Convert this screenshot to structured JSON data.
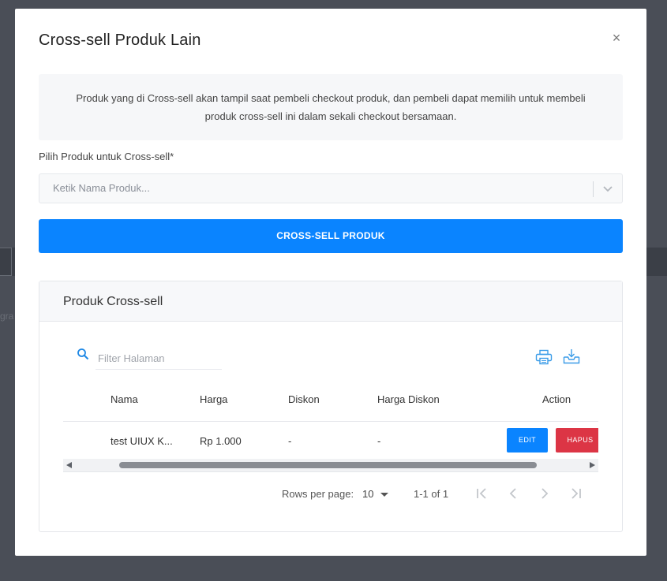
{
  "backdrop": {
    "partial_text": "gra"
  },
  "modal": {
    "title": "Cross-sell Produk Lain",
    "close_label": "×",
    "info_text": "Produk yang di Cross-sell akan tampil saat pembeli checkout produk, dan pembeli dapat memilih untuk membeli produk cross-sell ini dalam sekali checkout bersamaan.",
    "field_label": "Pilih Produk untuk Cross-sell*",
    "select_placeholder": "Ketik Nama Produk...",
    "submit_label": "CROSS-SELL PRODUK"
  },
  "card": {
    "title": "Produk Cross-sell",
    "filter_placeholder": "Filter Halaman",
    "table": {
      "columns": [
        "Nama",
        "Harga",
        "Diskon",
        "Harga Diskon",
        "Action"
      ],
      "rows": [
        {
          "nama": "test UIUX K...",
          "harga": "Rp 1.000",
          "diskon": "-",
          "harga_diskon": "-",
          "edit_label": "EDIT",
          "hapus_label": "HAPUS"
        }
      ]
    },
    "pagination": {
      "rows_per_page_label": "Rows per page:",
      "rows_per_page_value": "10",
      "range": "1-1 of 1"
    }
  },
  "colors": {
    "primary": "#0a84ff",
    "danger": "#dc3545",
    "backdrop": "#4a4e57"
  },
  "icons": [
    "close-icon",
    "chevron-down-icon",
    "search-icon",
    "print-icon",
    "download-icon",
    "first-page-icon",
    "previous-page-icon",
    "next-page-icon",
    "last-page-icon"
  ]
}
